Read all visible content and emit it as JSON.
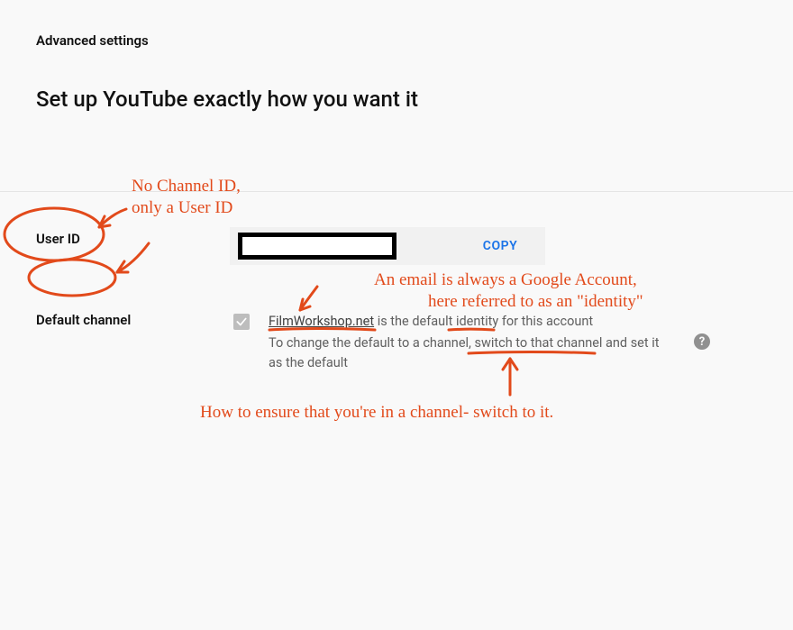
{
  "header": {
    "breadcrumb": "Advanced settings",
    "title": "Set up YouTube exactly how you want it"
  },
  "user_id_row": {
    "label": "User ID",
    "value": "",
    "copy_label": "COPY"
  },
  "default_channel_row": {
    "label": "Default channel",
    "checked": true,
    "brand_name": "FilmWorkshop.net",
    "line1_rest": " is the default identity for this account",
    "line2": "To change the default to a channel, switch to that channel and set it as the default",
    "help_tooltip": "?"
  },
  "annotations": {
    "a1_line1": "No Channel ID,",
    "a1_line2": "only  a User ID",
    "a2_line1": "An email is always a Google Account,",
    "a2_line2": "here referred to as an \"identity\"",
    "a3": "How to ensure that you're in a channel-  switch to it."
  }
}
